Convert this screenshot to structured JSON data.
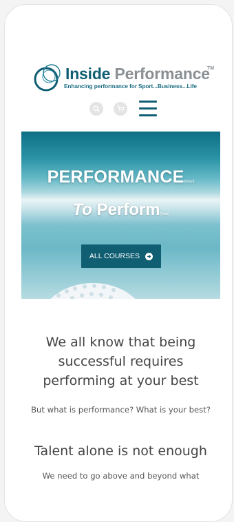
{
  "brand": {
    "name_part1": "Inside",
    "name_part2": "Performance",
    "trademark": "TM",
    "tagline": "Enhancing performance for Sport...Business...Life"
  },
  "header": {
    "icons": [
      "search-icon",
      "cart-icon",
      "menu-icon"
    ]
  },
  "hero": {
    "line1_text": "PERFORMANCE",
    "line1_tag": "[Noun]",
    "line2_prefix": "To",
    "line2_text": "Perform",
    "line2_tag": "[Verb]",
    "button_label": "ALL COURSES"
  },
  "content": {
    "heading1": "We all know that being successful requires performing at your best",
    "para1": "But what is performance? What is your best?",
    "heading2": "Talent alone is not enough",
    "para2": "We need to go above and beyond what"
  },
  "colors": {
    "brand_teal": "#0f5e72",
    "brand_grey": "#8a8f93",
    "text": "#444444"
  }
}
